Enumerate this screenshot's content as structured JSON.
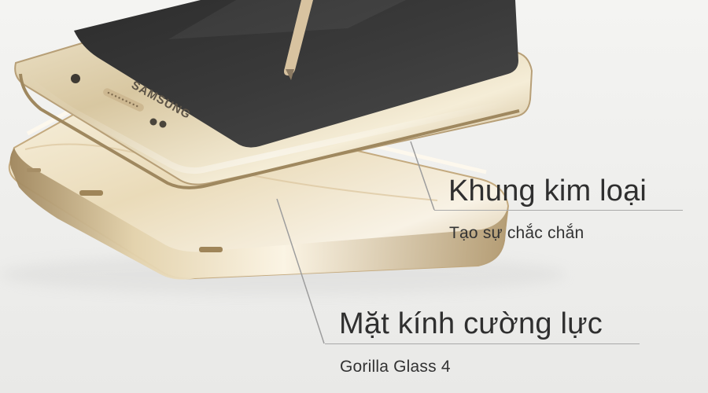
{
  "callouts": {
    "frame": {
      "title": "Khung kim loại",
      "subtitle": "Tạo sự chắc chắn"
    },
    "glass": {
      "title": "Mặt kính cường lực",
      "subtitle": "Gorilla Glass 4"
    }
  },
  "device": {
    "brand_logo": "SAMSUNG"
  },
  "colors": {
    "background": "#f0f0ee",
    "gold": "#d8c7a1",
    "gold_dark": "#a9936b",
    "screen": "#2b2b2b",
    "text": "#2f2f2f",
    "line": "#a9a9a9"
  }
}
